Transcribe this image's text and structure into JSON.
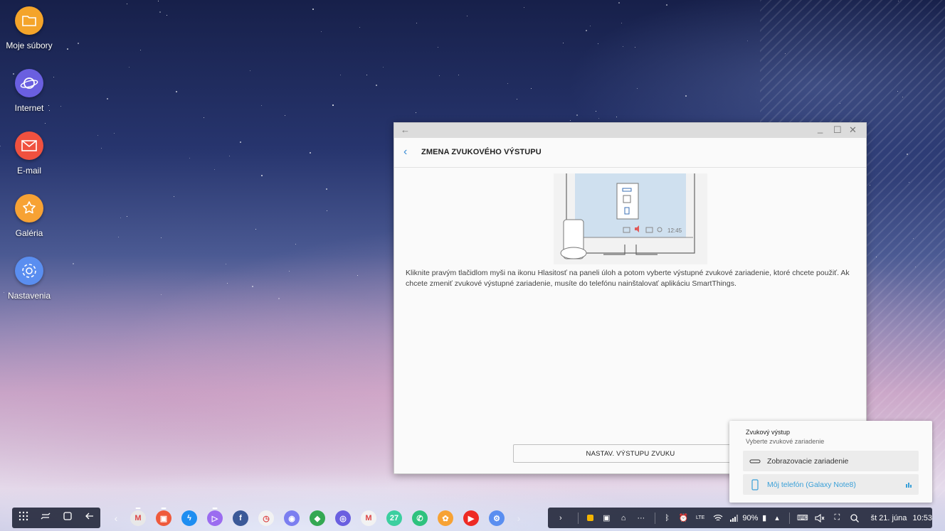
{
  "desktop": {
    "icons": [
      {
        "label": "Moje súbory",
        "icon": "folder-icon",
        "color": "#f4a42a"
      },
      {
        "label": "Internet",
        "icon": "internet-icon",
        "color": "#6a5fe0"
      },
      {
        "label": "E-mail",
        "icon": "email-icon",
        "color": "#f0513f"
      },
      {
        "label": "Galéria",
        "icon": "gallery-icon",
        "color": "#f7a234"
      },
      {
        "label": "Nastavenia",
        "icon": "settings-icon",
        "color": "#5a8ef0"
      }
    ]
  },
  "window": {
    "title": "ZMENA ZVUKOVÉHO VÝSTUPU",
    "illustration_time": "12:45",
    "description": "Kliknite pravým tlačidlom myši na ikonu Hlasitosť na paneli úloh a potom vyberte výstupné zvukové zariadenie, ktoré chcete použiť. Ak chcete zmeniť zvukové výstupné zariadenie, musíte do telefónu nainštalovať aplikáciu SmartThings.",
    "button_label": "NASTAV. VÝSTUPU ZVUKU",
    "controls": {
      "minimize": "_",
      "maximize": "☐",
      "close": "✕",
      "back": "←"
    }
  },
  "sound_popup": {
    "title": "Zvukový výstup",
    "subtitle": "Vyberte zvukové zariadenie",
    "options": [
      {
        "label": "Zobrazovacie zariadenie",
        "icon": "display-device-icon",
        "selected": false
      },
      {
        "label": "Môj telefón (Galaxy Note8)",
        "icon": "phone-icon",
        "selected": true
      }
    ],
    "accent": "#3aa0d8"
  },
  "taskbar": {
    "apps": [
      {
        "name": "gmail",
        "color": "#e8e8e8",
        "glyph": "M",
        "running": true
      },
      {
        "name": "app-red",
        "color": "#ef5a3c",
        "glyph": "▣",
        "running": true
      },
      {
        "name": "messenger",
        "color": "#1f8ef1",
        "glyph": "ϟ",
        "running": false
      },
      {
        "name": "play",
        "color": "#9b6cf0",
        "glyph": "▷",
        "running": true
      },
      {
        "name": "facebook",
        "color": "#3b5998",
        "glyph": "f",
        "running": false
      },
      {
        "name": "clock",
        "color": "#f2f2f2",
        "glyph": "◷",
        "running": false
      },
      {
        "name": "camera",
        "color": "#7b7ef0",
        "glyph": "◉",
        "running": false
      },
      {
        "name": "maps",
        "color": "#34a853",
        "glyph": "◆",
        "running": false
      },
      {
        "name": "internet",
        "color": "#6a5fe0",
        "glyph": "◎",
        "running": false
      },
      {
        "name": "gmail2",
        "color": "#f2f2f2",
        "glyph": "M",
        "running": false
      },
      {
        "name": "calendar",
        "color": "#3ccfa0",
        "glyph": "27",
        "running": false
      },
      {
        "name": "phone",
        "color": "#2ec27e",
        "glyph": "✆",
        "running": false
      },
      {
        "name": "gallery",
        "color": "#f7a234",
        "glyph": "✿",
        "running": false
      },
      {
        "name": "youtube",
        "color": "#ee2a24",
        "glyph": "▶",
        "running": false
      },
      {
        "name": "settings",
        "color": "#5a8ef0",
        "glyph": "⚙",
        "running": false
      }
    ],
    "battery": "90%",
    "date": "št 21. júna",
    "time": "10:53"
  }
}
